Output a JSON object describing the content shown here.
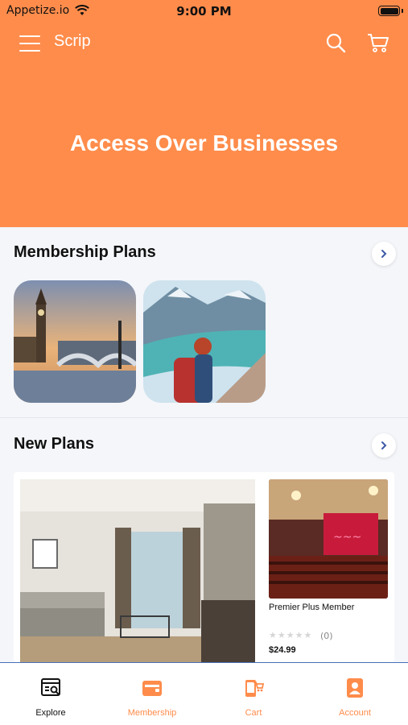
{
  "status_bar": {
    "carrier": "Appetize.io",
    "time": "9:00 PM"
  },
  "header": {
    "app_title": "Scrip",
    "hero_text": "Access Over Businesses"
  },
  "membership_section": {
    "title": "Membership Plans"
  },
  "new_plans_section": {
    "title": "New Plans",
    "product": {
      "name": "Premier Plus Member",
      "rating_count": "(0)",
      "price": "$24.99",
      "stars": "★★★★★"
    }
  },
  "bottom_nav": {
    "items": [
      {
        "label": "Explore",
        "icon": "explore-icon",
        "active": true
      },
      {
        "label": "Membership",
        "icon": "membership-icon",
        "active": false
      },
      {
        "label": "Cart",
        "icon": "cart-icon",
        "active": false
      },
      {
        "label": "Account",
        "icon": "account-icon",
        "active": false
      }
    ]
  },
  "colors": {
    "accent": "#ff8c4b",
    "nav_border": "#4a6fb5",
    "active_label": "#111111"
  }
}
